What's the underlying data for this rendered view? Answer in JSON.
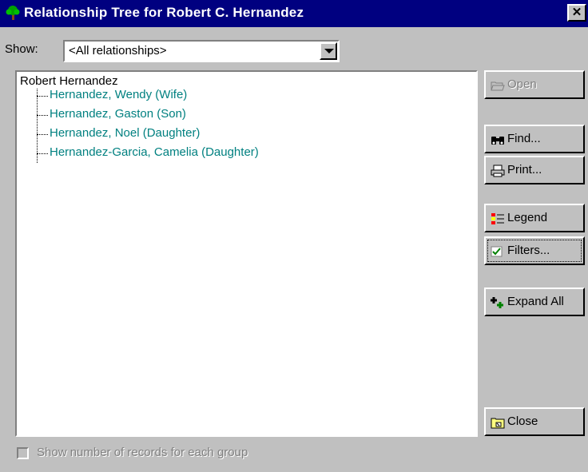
{
  "window": {
    "title": "Relationship Tree for Robert C. Hernandez",
    "close_label": "✕"
  },
  "show": {
    "label": "Show:",
    "selected": "<All relationships>"
  },
  "tree": {
    "root": "Robert Hernandez",
    "children": [
      {
        "label": "Hernandez, Wendy (Wife)"
      },
      {
        "label": "Hernandez, Gaston (Son)"
      },
      {
        "label": "Hernandez, Noel (Daughter)"
      },
      {
        "label": "Hernandez-Garcia, Camelia (Daughter)"
      }
    ]
  },
  "buttons": {
    "open": {
      "label": "Open",
      "icon": "folder-open-icon",
      "enabled": false
    },
    "find": {
      "label": "Find...",
      "icon": "binoculars-icon"
    },
    "print": {
      "label": "Print...",
      "icon": "printer-icon"
    },
    "legend": {
      "label": "Legend",
      "icon": "legend-icon"
    },
    "filters": {
      "label": "Filters...",
      "icon": "checkmark-icon"
    },
    "expand_all": {
      "label": "Expand All",
      "icon": "expand-tree-icon"
    },
    "close": {
      "label": "Close",
      "icon": "close-folder-icon"
    }
  },
  "footer": {
    "checkbox_label": "Show number of records for each group",
    "checked": false,
    "enabled": false
  },
  "colors": {
    "titlebar": "#000080",
    "tree_child_text": "#008080",
    "face": "#c0c0c0"
  }
}
